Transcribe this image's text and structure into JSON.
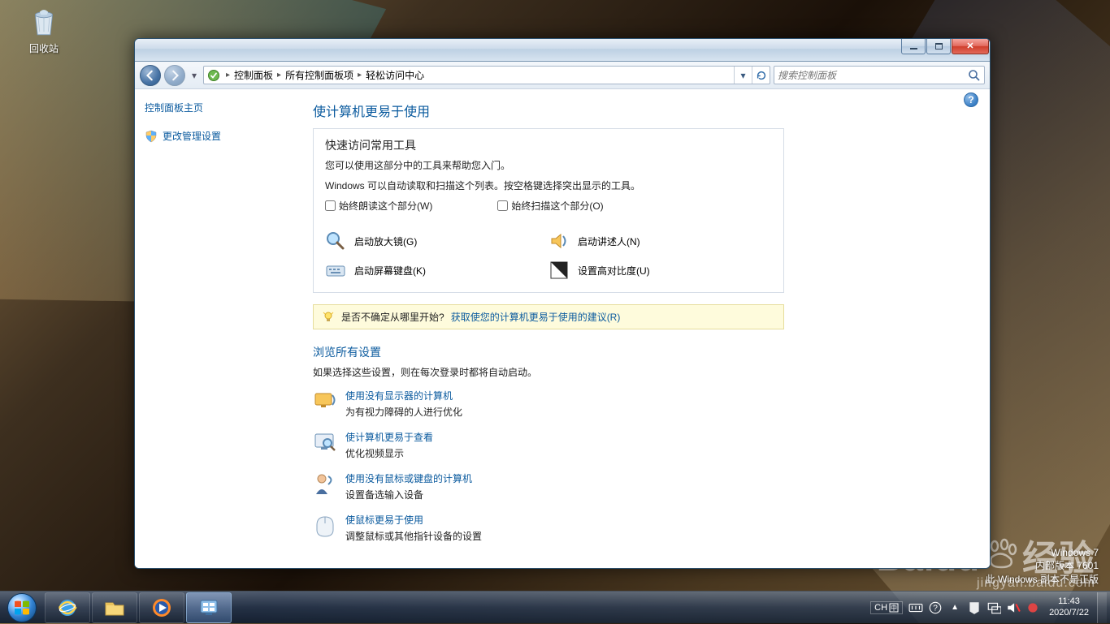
{
  "desktop": {
    "recycle_bin": "回收站"
  },
  "watermark": {
    "os": "Windows 7",
    "build": "内部版本 7601",
    "genuine": "此 Windows 副本不是正版",
    "baidu_big": "Baidu",
    "baidu_jingyan": "经验",
    "baidu_url": "jingyan.baidu.com"
  },
  "window": {
    "breadcrumb": [
      "控制面板",
      "所有控制面板项",
      "轻松访问中心"
    ],
    "search_placeholder": "搜索控制面板"
  },
  "sidebar": {
    "home": "控制面板主页",
    "admin": "更改管理设置"
  },
  "main": {
    "title": "使计算机更易于使用",
    "tools_title": "快速访问常用工具",
    "tools_p1": "您可以使用这部分中的工具来帮助您入门。",
    "tools_p2": "Windows 可以自动读取和扫描这个列表。按空格键选择突出显示的工具。",
    "cb1": "始终朗读这个部分(W)",
    "cb2": "始终扫描这个部分(O)",
    "tool_magnifier": "启动放大镜(G)",
    "tool_narrator": "启动讲述人(N)",
    "tool_osk": "启动屏幕键盘(K)",
    "tool_contrast": "设置高对比度(U)",
    "hint_q": "是否不确定从哪里开始?",
    "hint_link": "获取使您的计算机更易于使用的建议(R)",
    "browse_title": "浏览所有设置",
    "browse_sub": "如果选择这些设置，则在每次登录时都将自动启动。",
    "options": [
      {
        "title": "使用没有显示器的计算机",
        "desc": "为有视力障碍的人进行优化"
      },
      {
        "title": "使计算机更易于查看",
        "desc": "优化视频显示"
      },
      {
        "title": "使用没有鼠标或键盘的计算机",
        "desc": "设置备选输入设备"
      },
      {
        "title": "使鼠标更易于使用",
        "desc": "调整鼠标或其他指针设备的设置"
      }
    ]
  },
  "tray": {
    "lang": "CH",
    "time": "11:43",
    "date": "2020/7/22"
  }
}
